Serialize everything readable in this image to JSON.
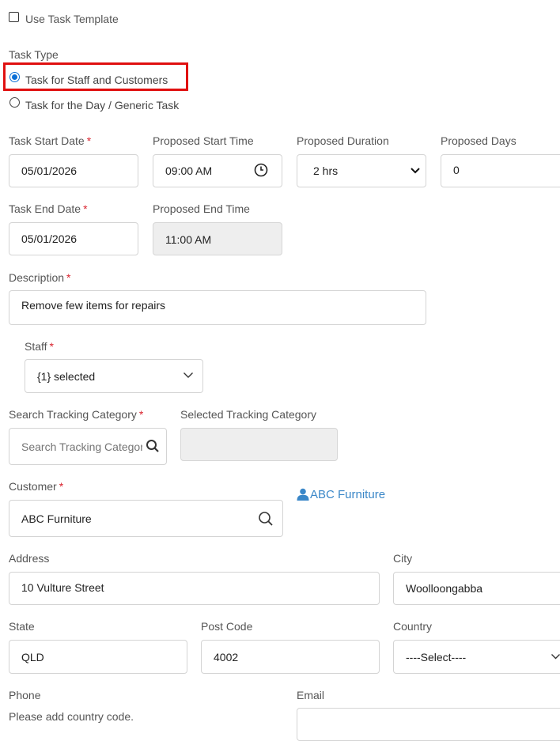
{
  "task_template": {
    "label": "Use Task Template",
    "checked": false
  },
  "task_type": {
    "label": "Task Type",
    "options": [
      {
        "label": "Task for Staff and Customers",
        "selected": true
      },
      {
        "label": "Task for the Day / Generic Task",
        "selected": false
      }
    ]
  },
  "required_mark": "*",
  "start_date": {
    "label": "Task Start Date",
    "value": "05/01/2026"
  },
  "start_time": {
    "label": "Proposed Start Time",
    "value": "09:00 AM"
  },
  "duration": {
    "label": "Proposed Duration",
    "value": "2 hrs"
  },
  "days": {
    "label": "Proposed Days",
    "value": "0"
  },
  "end_date": {
    "label": "Task End Date",
    "value": "05/01/2026"
  },
  "end_time": {
    "label": "Proposed End Time",
    "value": "11:00 AM"
  },
  "description": {
    "label": "Description",
    "value": "Remove few items for repairs"
  },
  "staff": {
    "label": "Staff",
    "value": "{1} selected"
  },
  "tracking": {
    "search_label": "Search Tracking Category",
    "search_placeholder": "Search Tracking Category",
    "selected_label": "Selected Tracking Category",
    "selected_value": ""
  },
  "customer": {
    "label": "Customer",
    "value": "ABC Furniture",
    "link": "ABC Furniture"
  },
  "address": {
    "label": "Address",
    "value": "10 Vulture Street"
  },
  "city": {
    "label": "City",
    "value": "Woolloongabba"
  },
  "state": {
    "label": "State",
    "value": "QLD"
  },
  "post_code": {
    "label": "Post Code",
    "value": "4002"
  },
  "country": {
    "label": "Country",
    "value": "----Select----"
  },
  "phone": {
    "label": "Phone",
    "hint": "Please add country code."
  },
  "email": {
    "label": "Email",
    "value": ""
  },
  "colors": {
    "accent": "#0b6fd6",
    "highlight": "#e01010",
    "required": "#d9232e",
    "link": "#3a87c8"
  },
  "icons": [
    "clock-icon",
    "chevron-down-icon",
    "search-icon",
    "user-icon"
  ]
}
